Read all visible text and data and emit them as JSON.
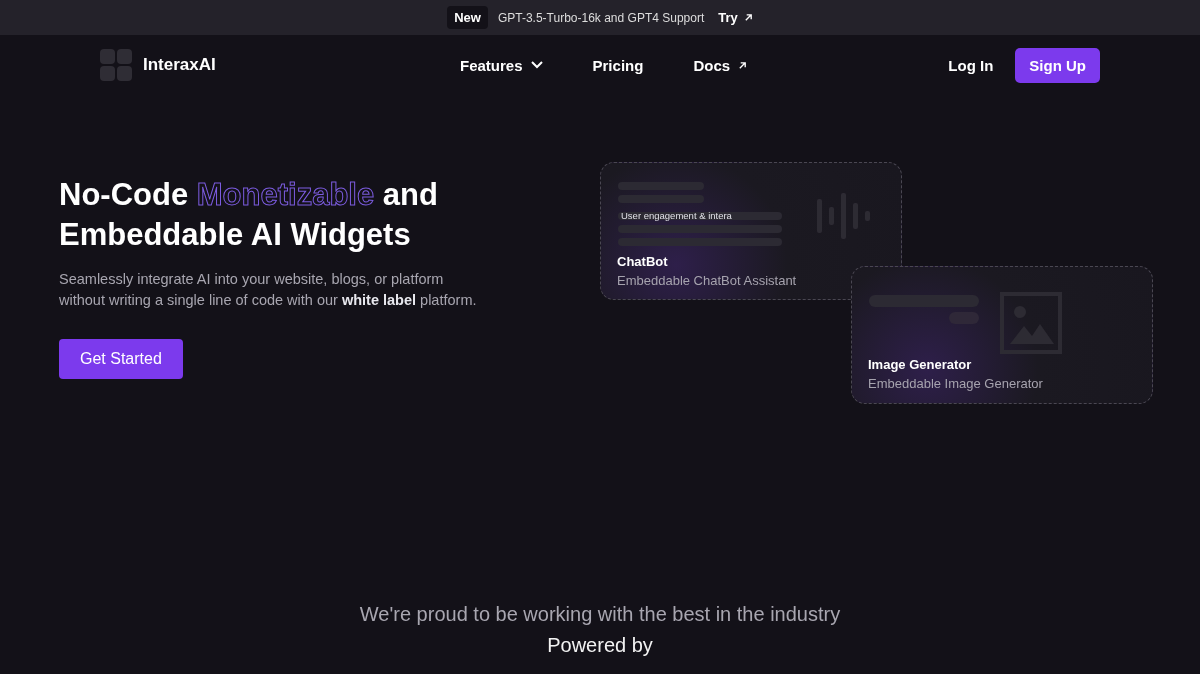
{
  "announcement": {
    "badge": "New",
    "text": "GPT-3.5-Turbo-16k and GPT4 Support",
    "link": "Try"
  },
  "nav": {
    "brand": "InteraxAI",
    "links": [
      {
        "label": "Features",
        "kind": "dropdown"
      },
      {
        "label": "Pricing",
        "kind": "plain"
      },
      {
        "label": "Docs",
        "kind": "external"
      }
    ],
    "login": "Log In",
    "signup": "Sign Up"
  },
  "hero": {
    "title_parts": [
      {
        "text": "No-Code ",
        "kind": "plain"
      },
      {
        "text": "Monetizable",
        "kind": "outline"
      },
      {
        "text": " and Embeddable AI Widgets",
        "kind": "plain"
      }
    ],
    "description": "Seamlessly integrate AI into your website, blogs, or platform without writing a single line of code with our **white label** platform.",
    "cta": "Get Started"
  },
  "widgets": [
    {
      "kind": "chat",
      "caption": "User engagement & intera",
      "title": "ChatBot",
      "subtitle": "Embeddable ChatBot Assistant"
    },
    {
      "kind": "image",
      "title": "Image Generator",
      "subtitle": "Embeddable Image Generator"
    }
  ],
  "partners": {
    "heading": "We're proud to be working with the best in the industry",
    "subheading": "Powered by"
  }
}
